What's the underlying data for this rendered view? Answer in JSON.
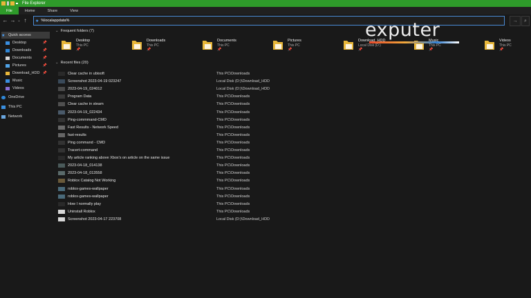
{
  "window": {
    "title": "File Explorer"
  },
  "ribbon": {
    "tabs": [
      "File",
      "Home",
      "Share",
      "View"
    ]
  },
  "address": {
    "value": "%localappdata%"
  },
  "sidebar": {
    "items": [
      {
        "label": "Quick access",
        "icon": "star-icon",
        "pinned": false,
        "selected": true
      },
      {
        "label": "Desktop",
        "icon": "desktop-icon",
        "pinned": true
      },
      {
        "label": "Downloads",
        "icon": "download-icon",
        "pinned": true
      },
      {
        "label": "Documents",
        "icon": "document-icon",
        "pinned": true
      },
      {
        "label": "Pictures",
        "icon": "pictures-icon",
        "pinned": true
      },
      {
        "label": "Download_HDD",
        "icon": "folder-icon",
        "pinned": true
      },
      {
        "label": "Music",
        "icon": "music-icon",
        "pinned": false
      },
      {
        "label": "Videos",
        "icon": "video-icon",
        "pinned": false
      },
      {
        "label": "OneDrive",
        "icon": "cloud-icon",
        "pinned": false
      },
      {
        "label": "This PC",
        "icon": "computer-icon",
        "pinned": false
      },
      {
        "label": "Network",
        "icon": "network-icon",
        "pinned": false
      }
    ]
  },
  "frequent": {
    "heading": "Frequent folders (7)",
    "folders": [
      {
        "name": "Desktop",
        "location": "This PC"
      },
      {
        "name": "Downloads",
        "location": "This PC"
      },
      {
        "name": "Documents",
        "location": "This PC"
      },
      {
        "name": "Pictures",
        "location": "This PC"
      },
      {
        "name": "Download_HDD",
        "location": "Local Disk (D:)"
      },
      {
        "name": "Music",
        "location": "This PC"
      },
      {
        "name": "Videos",
        "location": "This PC"
      }
    ]
  },
  "recent": {
    "heading": "Recent files (20)",
    "files": [
      {
        "name": "Clear cache in ubisoft",
        "location": "This PC\\Downloads"
      },
      {
        "name": "Screenshot 2023-04-19 023247",
        "location": "Local Disk (D:)\\Download_HDD"
      },
      {
        "name": "2023-04-19_024012",
        "location": "Local Disk (D:)\\Download_HDD"
      },
      {
        "name": "Program Data",
        "location": "This PC\\Downloads"
      },
      {
        "name": "Clear cache in steam",
        "location": "This PC\\Downloads"
      },
      {
        "name": "2023-04-19_022434",
        "location": "This PC\\Downloads"
      },
      {
        "name": "Ping-commmand-CMD",
        "location": "This PC\\Downloads"
      },
      {
        "name": "Fast Results - Network Speed",
        "location": "This PC\\Downloads"
      },
      {
        "name": "fast-results",
        "location": "This PC\\Downloads"
      },
      {
        "name": "Ping command - CMD",
        "location": "This PC\\Downloads"
      },
      {
        "name": "Tracert-command",
        "location": "This PC\\Downloads"
      },
      {
        "name": "My article ranking above Xbox's on article on the same issue",
        "location": "This PC\\Downloads"
      },
      {
        "name": "2023-04-18_014138",
        "location": "This PC\\Downloads"
      },
      {
        "name": "2023-04-18_013558",
        "location": "This PC\\Downloads"
      },
      {
        "name": "Roblox Catalog Not Working",
        "location": "This PC\\Downloads"
      },
      {
        "name": "roblox-games-wallpaper",
        "location": "This PC\\Downloads"
      },
      {
        "name": "roblox-games-wallpaper",
        "location": "This PC\\Downloads"
      },
      {
        "name": "How I normally play",
        "location": "This PC\\Downloads"
      },
      {
        "name": "Uninstall Roblox",
        "location": "This PC\\Downloads"
      },
      {
        "name": "Screenshot 2023-04-17 223708",
        "location": "Local Disk (D:)\\Download_HDD"
      }
    ]
  },
  "watermark": {
    "text": "exputer"
  },
  "colors": {
    "accent": "#2e9a2a",
    "folder": "#e8b73a",
    "selection": "#3b3b3b"
  }
}
